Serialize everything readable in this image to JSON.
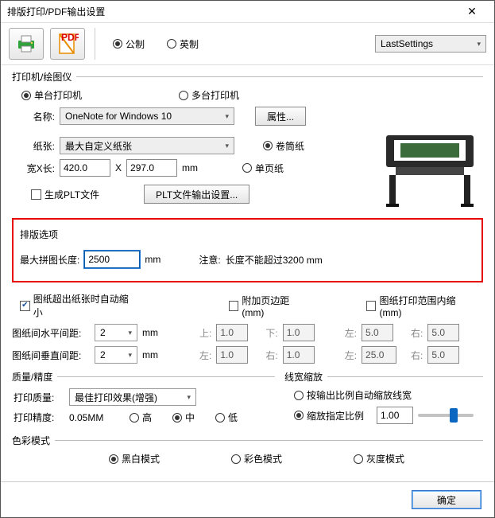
{
  "window": {
    "title": "排版打印/PDF输出设置",
    "close": "✕"
  },
  "units": {
    "metric": "公制",
    "imperial": "英制"
  },
  "preset": {
    "selected": "LastSettings"
  },
  "printer_section": {
    "legend": "打印机/绘图仪",
    "single": "单台打印机",
    "multi": "多台打印机",
    "name_label": "名称:",
    "name_value": "OneNote for Windows 10",
    "prop_btn": "属性...",
    "paper_label": "纸张:",
    "paper_value": "最大自定义纸张",
    "roll": "卷筒纸",
    "sheet": "单页纸",
    "wh_label": "宽X长:",
    "width": "420.0",
    "height": "297.0",
    "wh_x": "X",
    "wh_unit": "mm",
    "plt_gen": "生成PLT文件",
    "plt_btn": "PLT文件输出设置..."
  },
  "layout_section": {
    "legend": "排版选项",
    "maxlen_label": "最大拼图长度:",
    "maxlen_value": "2500",
    "maxlen_unit": "mm",
    "note_label": "注意:",
    "note_text": "长度不能超过3200 mm",
    "auto_shrink": "图纸超出纸张时自动缩小",
    "add_margin": "附加页边距(mm)",
    "print_inset": "图纸打印范围内缩(mm)",
    "hgap_label": "图纸间水平间距:",
    "vgap_label": "图纸间垂直间距:",
    "hgap": "2",
    "vgap": "2",
    "unit": "mm",
    "top": "上:",
    "top_v": "1.0",
    "bottom": "下:",
    "bottom_v": "1.0",
    "left": "左:",
    "left_v": "5.0",
    "left_v2": "25.0",
    "right": "右:",
    "right_v": "5.0",
    "right_v2": "5.0",
    "top2_v": "1.0",
    "bottom2_v": "1.0"
  },
  "quality_section": {
    "legend": "质量/精度",
    "quality_label": "打印质量:",
    "quality_value": "最佳打印效果(增强)",
    "precision_label": "打印精度:",
    "precision_value": "0.05MM",
    "hi": "高",
    "mid": "中",
    "lo": "低"
  },
  "linewidth_section": {
    "legend": "线宽缩放",
    "auto": "按输出比例自动缩放线宽",
    "manual": "缩放指定比例",
    "ratio": "1.00"
  },
  "color_section": {
    "legend": "色彩模式",
    "bw": "黑白模式",
    "color": "彩色模式",
    "gray": "灰度模式"
  },
  "footer": {
    "ok": "确定"
  }
}
